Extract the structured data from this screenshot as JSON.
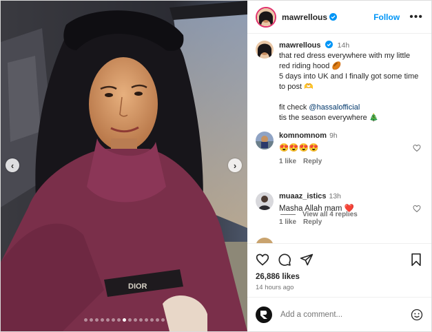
{
  "post": {
    "username": "mawrellous",
    "follow_label": "Follow",
    "more_label": "•••"
  },
  "caption": {
    "username": "mawrellous",
    "time": "14h",
    "line1": "that red dress everywhere with my little red riding hood 🏉",
    "line2": "5 days into UK and I finally got some time to post 🫶",
    "line3_prefix": "fit check ",
    "mention": "@hassalofficial",
    "line4": "tis the season everywhere 🎄"
  },
  "comments": [
    {
      "username": "komnomnom",
      "time": "9h",
      "text": "😍😍😍😍",
      "likes": "1 like",
      "reply": "Reply",
      "view_replies": "View all 4 replies"
    },
    {
      "username": "muaaz_istics",
      "time": "13h",
      "text": "Masha Allah mam ❤️",
      "likes": "1 like",
      "reply": "Reply"
    }
  ],
  "stats": {
    "likes": "26,886 likes",
    "posted": "14 hours ago"
  },
  "composer": {
    "placeholder": "Add a comment..."
  },
  "carousel": {
    "slide_count": 15,
    "active_index": 7
  },
  "colors": {
    "accent": "#0095f6",
    "sweater": "#7a2f4a",
    "verified": "#0095f6"
  }
}
